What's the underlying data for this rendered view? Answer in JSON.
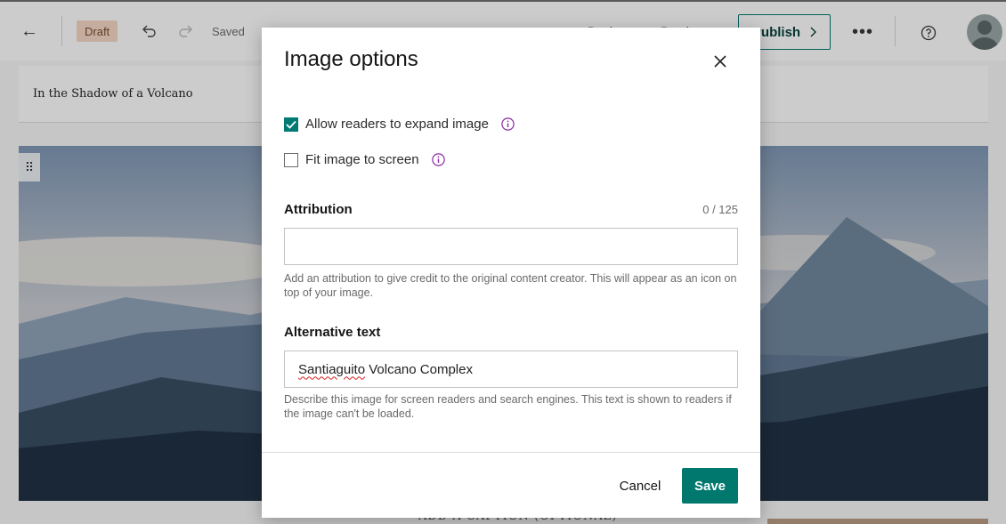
{
  "topbar": {
    "back_icon": "arrow-left-icon",
    "draft_badge": "Draft",
    "undo_icon": "undo-icon",
    "redo_icon": "redo-icon",
    "saved_status": "Saved",
    "design_tab": "Design",
    "preview_tab": "Preview",
    "publish_label": "Publish",
    "more_icon": "ellipsis-icon",
    "help_icon": "question-circle-icon",
    "avatar_icon": "user-avatar-icon"
  },
  "story": {
    "title": "In the Shadow of a Volcano",
    "below_hero_text": "ADD A CAPTION (OPTIONAL)"
  },
  "modal": {
    "title": "Image options",
    "close_icon": "close-icon",
    "options": [
      {
        "label": "Allow readers to expand image",
        "checked": true
      },
      {
        "label": "Fit image to screen",
        "checked": false
      }
    ],
    "attribution": {
      "label": "Attribution",
      "counter": "0 / 125",
      "value": "",
      "help": "Add an attribution to give credit to the original content creator. This will appear as an icon on top of your image."
    },
    "alt_text": {
      "label": "Alternative text",
      "value_misspelled": "Santiaguito",
      "value_rest": " Volcano Complex",
      "help": "Describe this image for screen readers and search engines. This text is shown to readers if the image can't be loaded."
    },
    "cancel_label": "Cancel",
    "save_label": "Save"
  },
  "colors": {
    "accent": "#00786e",
    "checkbox_checked": "#007a73",
    "info_icon": "#8a2aa8",
    "draft_badge_bg": "#f5d8c6"
  }
}
